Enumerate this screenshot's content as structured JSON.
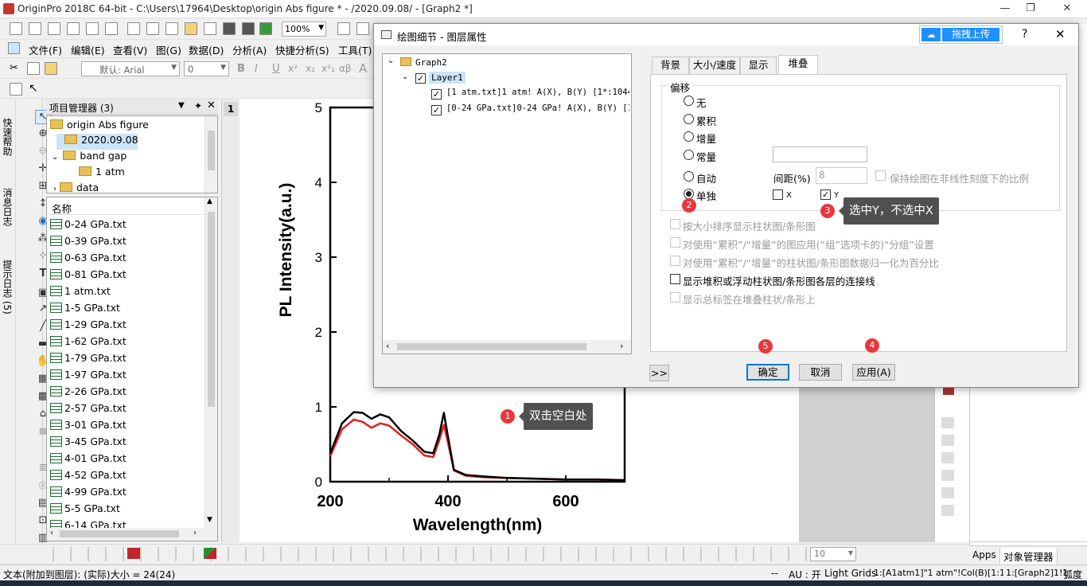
{
  "app": {
    "title": "OriginPro 2018C 64-bit - C:\\Users\\17964\\Desktop\\origin Abs figure * - /2020.09.08/ - [Graph2 *]",
    "minimize_glyph": "—",
    "restore_glyph": "❐",
    "close_glyph": "✕"
  },
  "toolbar": {
    "zoom_value": "100%",
    "font_name": "默认: Arial",
    "font_size": "0",
    "bold": "B",
    "italic": "I",
    "underline": "U",
    "superscript": "x²",
    "subscript": "x₂",
    "supsub": "x²₁",
    "greek": "αβ",
    "big_a": "A"
  },
  "menu": [
    {
      "label": "文件(F)"
    },
    {
      "label": "编辑(E)"
    },
    {
      "label": "查看(V)"
    },
    {
      "label": "图(G)"
    },
    {
      "label": "数据(D)"
    },
    {
      "label": "分析(A)"
    },
    {
      "label": "快捷分析(S)"
    },
    {
      "label": "工具(T)"
    }
  ],
  "side_tabs": {
    "quick_help": "快速帮助",
    "message_log": "消息日志",
    "hint_log": "提示日志 (5)"
  },
  "project_manager": {
    "title": "项目管理器 (3)",
    "tree": [
      {
        "label": "origin Abs figure"
      },
      {
        "label": "2020.09.08"
      },
      {
        "label": "band gap"
      },
      {
        "label": "1 atm"
      },
      {
        "label": "data"
      }
    ],
    "list_header": "名称",
    "files": [
      "0-24 GPa.txt",
      "0-39 GPa.txt",
      "0-63 GPa.txt",
      "0-81 GPa.txt",
      "1 atm.txt",
      "1-5 GPa.txt",
      "1-29 GPa.txt",
      "1-62 GPa.txt",
      "1-79 GPa.txt",
      "1-97 GPa.txt",
      "2-26 GPa.txt",
      "2-57 GPa.txt",
      "3-01 GPa.txt",
      "3-45 GPa.txt",
      "4-01 GPa.txt",
      "4-52 GPa.txt",
      "4-99 GPa.txt",
      "5-5 GPa.txt",
      "6-14 GPa.txt"
    ]
  },
  "graph": {
    "layer_tab": "1",
    "ylabel": "PL Intensity(a.u.)",
    "xlabel": "Wavelength(nm)",
    "y_ticks": [
      "0",
      "1",
      "2",
      "3",
      "4",
      "5"
    ],
    "x_ticks": [
      "200",
      "400",
      "600"
    ]
  },
  "chart_data": {
    "type": "line",
    "xlabel": "Wavelength(nm)",
    "ylabel": "PL Intensity(a.u.)",
    "xlim": [
      200,
      700
    ],
    "ylim": [
      0,
      5
    ],
    "x": [
      200,
      220,
      240,
      255,
      270,
      285,
      300,
      320,
      340,
      360,
      375,
      385,
      393,
      400,
      410,
      430,
      460,
      500,
      550,
      600,
      650,
      700
    ],
    "series": [
      {
        "values": [
          0.38,
          0.78,
          0.93,
          0.92,
          0.84,
          0.9,
          0.86,
          0.68,
          0.55,
          0.4,
          0.38,
          0.62,
          0.92,
          0.6,
          0.16,
          0.09,
          0.07,
          0.05,
          0.04,
          0.03,
          0.03,
          0.02
        ],
        "color": "#000000"
      },
      {
        "values": [
          0.34,
          0.7,
          0.83,
          0.8,
          0.72,
          0.78,
          0.75,
          0.62,
          0.5,
          0.35,
          0.33,
          0.55,
          0.76,
          0.52,
          0.15,
          0.08,
          0.06,
          0.05,
          0.04,
          0.03,
          0.03,
          0.02
        ],
        "color": "#e02020"
      }
    ]
  },
  "dialog": {
    "title": "绘图细节 - 图层属性",
    "upload_label": "拖拽上传",
    "help_glyph": "?",
    "close_glyph": "✕",
    "tree": [
      {
        "label": "Graph2"
      },
      {
        "label": "Layer1"
      },
      {
        "label": "[1 atm.txt]1 atm! A(X), B(Y) [1*:1044*"
      },
      {
        "label": "[0-24 GPa.txt]0-24 GPa! A(X), B(Y) [1*"
      }
    ],
    "tabs": [
      {
        "label": "背景"
      },
      {
        "label": "大小/速度"
      },
      {
        "label": "显示"
      },
      {
        "label": "堆叠"
      }
    ],
    "offset_group": "偏移",
    "offset_options": [
      {
        "label": "无",
        "selected": false
      },
      {
        "label": "累积",
        "selected": false
      },
      {
        "label": "增量",
        "selected": false
      },
      {
        "label": "常量",
        "selected": false
      },
      {
        "label": "自动",
        "selected": false
      },
      {
        "label": "单独",
        "selected": true
      }
    ],
    "constant_value": "",
    "gap_label": "间距(%)",
    "gap_value": "8",
    "keep_ratio_label": "保持绘图在非线性刻度下的比例",
    "x_label": "X",
    "y_label": "Y",
    "x_checked": false,
    "y_checked": true,
    "options": [
      {
        "label": "按大小排序显示柱状图/条形图",
        "enabled": false,
        "checked": false
      },
      {
        "label": "对使用“累积”/“增量”的图应用(“组”选项卡的)“分组”设置",
        "enabled": false,
        "checked": false
      },
      {
        "label": "对使用“累积”/“增量”的柱状图/条形图数据归一化为百分比",
        "enabled": false,
        "checked": false
      },
      {
        "label": "显示堆积或浮动柱状图/条形图各层的连接线",
        "enabled": true,
        "checked": false
      },
      {
        "label": "显示总标签在堆叠柱状/条形上",
        "enabled": false,
        "checked": false
      }
    ],
    "expand_button": ">>",
    "ok_button": "确定",
    "cancel_button": "取消",
    "apply_button": "应用(A)"
  },
  "annotations": {
    "m1": "1",
    "m2": "2",
    "m3": "3",
    "m4": "4",
    "m5": "5",
    "callout1": "双击空白处",
    "callout3": "选中Y，不选中X"
  },
  "right_panel": {
    "apps_tab": "Apps",
    "objects_tab": "对象管理器"
  },
  "bottom_toolbar": {
    "size_value": "10"
  },
  "statusbar": {
    "left": "文本(附加到图层): (实际)大小 = 24(24)",
    "dashes": "--",
    "au": "AU : 开",
    "grids": "Light Grids",
    "ref1": "1:[A1atm1]\"1 atm\"!Col(B)[1:1044]",
    "ref2": "1:[Graph2]1!1",
    "unit": "弧度"
  },
  "colors": {
    "accent": "#0078d7",
    "marker": "#e8383d",
    "upload": "#1e90ff",
    "series1": "#000000",
    "series2": "#e02020"
  }
}
